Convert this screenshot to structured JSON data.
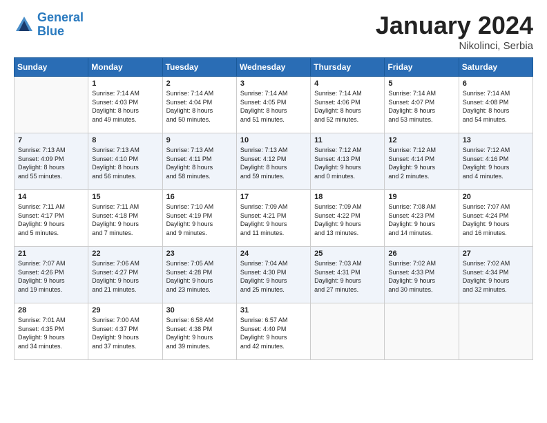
{
  "header": {
    "logo_line1": "General",
    "logo_line2": "Blue",
    "month": "January 2024",
    "location": "Nikolinci, Serbia"
  },
  "days_of_week": [
    "Sunday",
    "Monday",
    "Tuesday",
    "Wednesday",
    "Thursday",
    "Friday",
    "Saturday"
  ],
  "weeks": [
    [
      {
        "day": "",
        "info": ""
      },
      {
        "day": "1",
        "info": "Sunrise: 7:14 AM\nSunset: 4:03 PM\nDaylight: 8 hours\nand 49 minutes."
      },
      {
        "day": "2",
        "info": "Sunrise: 7:14 AM\nSunset: 4:04 PM\nDaylight: 8 hours\nand 50 minutes."
      },
      {
        "day": "3",
        "info": "Sunrise: 7:14 AM\nSunset: 4:05 PM\nDaylight: 8 hours\nand 51 minutes."
      },
      {
        "day": "4",
        "info": "Sunrise: 7:14 AM\nSunset: 4:06 PM\nDaylight: 8 hours\nand 52 minutes."
      },
      {
        "day": "5",
        "info": "Sunrise: 7:14 AM\nSunset: 4:07 PM\nDaylight: 8 hours\nand 53 minutes."
      },
      {
        "day": "6",
        "info": "Sunrise: 7:14 AM\nSunset: 4:08 PM\nDaylight: 8 hours\nand 54 minutes."
      }
    ],
    [
      {
        "day": "7",
        "info": "Sunrise: 7:13 AM\nSunset: 4:09 PM\nDaylight: 8 hours\nand 55 minutes."
      },
      {
        "day": "8",
        "info": "Sunrise: 7:13 AM\nSunset: 4:10 PM\nDaylight: 8 hours\nand 56 minutes."
      },
      {
        "day": "9",
        "info": "Sunrise: 7:13 AM\nSunset: 4:11 PM\nDaylight: 8 hours\nand 58 minutes."
      },
      {
        "day": "10",
        "info": "Sunrise: 7:13 AM\nSunset: 4:12 PM\nDaylight: 8 hours\nand 59 minutes."
      },
      {
        "day": "11",
        "info": "Sunrise: 7:12 AM\nSunset: 4:13 PM\nDaylight: 9 hours\nand 0 minutes."
      },
      {
        "day": "12",
        "info": "Sunrise: 7:12 AM\nSunset: 4:14 PM\nDaylight: 9 hours\nand 2 minutes."
      },
      {
        "day": "13",
        "info": "Sunrise: 7:12 AM\nSunset: 4:16 PM\nDaylight: 9 hours\nand 4 minutes."
      }
    ],
    [
      {
        "day": "14",
        "info": "Sunrise: 7:11 AM\nSunset: 4:17 PM\nDaylight: 9 hours\nand 5 minutes."
      },
      {
        "day": "15",
        "info": "Sunrise: 7:11 AM\nSunset: 4:18 PM\nDaylight: 9 hours\nand 7 minutes."
      },
      {
        "day": "16",
        "info": "Sunrise: 7:10 AM\nSunset: 4:19 PM\nDaylight: 9 hours\nand 9 minutes."
      },
      {
        "day": "17",
        "info": "Sunrise: 7:09 AM\nSunset: 4:21 PM\nDaylight: 9 hours\nand 11 minutes."
      },
      {
        "day": "18",
        "info": "Sunrise: 7:09 AM\nSunset: 4:22 PM\nDaylight: 9 hours\nand 13 minutes."
      },
      {
        "day": "19",
        "info": "Sunrise: 7:08 AM\nSunset: 4:23 PM\nDaylight: 9 hours\nand 14 minutes."
      },
      {
        "day": "20",
        "info": "Sunrise: 7:07 AM\nSunset: 4:24 PM\nDaylight: 9 hours\nand 16 minutes."
      }
    ],
    [
      {
        "day": "21",
        "info": "Sunrise: 7:07 AM\nSunset: 4:26 PM\nDaylight: 9 hours\nand 19 minutes."
      },
      {
        "day": "22",
        "info": "Sunrise: 7:06 AM\nSunset: 4:27 PM\nDaylight: 9 hours\nand 21 minutes."
      },
      {
        "day": "23",
        "info": "Sunrise: 7:05 AM\nSunset: 4:28 PM\nDaylight: 9 hours\nand 23 minutes."
      },
      {
        "day": "24",
        "info": "Sunrise: 7:04 AM\nSunset: 4:30 PM\nDaylight: 9 hours\nand 25 minutes."
      },
      {
        "day": "25",
        "info": "Sunrise: 7:03 AM\nSunset: 4:31 PM\nDaylight: 9 hours\nand 27 minutes."
      },
      {
        "day": "26",
        "info": "Sunrise: 7:02 AM\nSunset: 4:33 PM\nDaylight: 9 hours\nand 30 minutes."
      },
      {
        "day": "27",
        "info": "Sunrise: 7:02 AM\nSunset: 4:34 PM\nDaylight: 9 hours\nand 32 minutes."
      }
    ],
    [
      {
        "day": "28",
        "info": "Sunrise: 7:01 AM\nSunset: 4:35 PM\nDaylight: 9 hours\nand 34 minutes."
      },
      {
        "day": "29",
        "info": "Sunrise: 7:00 AM\nSunset: 4:37 PM\nDaylight: 9 hours\nand 37 minutes."
      },
      {
        "day": "30",
        "info": "Sunrise: 6:58 AM\nSunset: 4:38 PM\nDaylight: 9 hours\nand 39 minutes."
      },
      {
        "day": "31",
        "info": "Sunrise: 6:57 AM\nSunset: 4:40 PM\nDaylight: 9 hours\nand 42 minutes."
      },
      {
        "day": "",
        "info": ""
      },
      {
        "day": "",
        "info": ""
      },
      {
        "day": "",
        "info": ""
      }
    ]
  ]
}
